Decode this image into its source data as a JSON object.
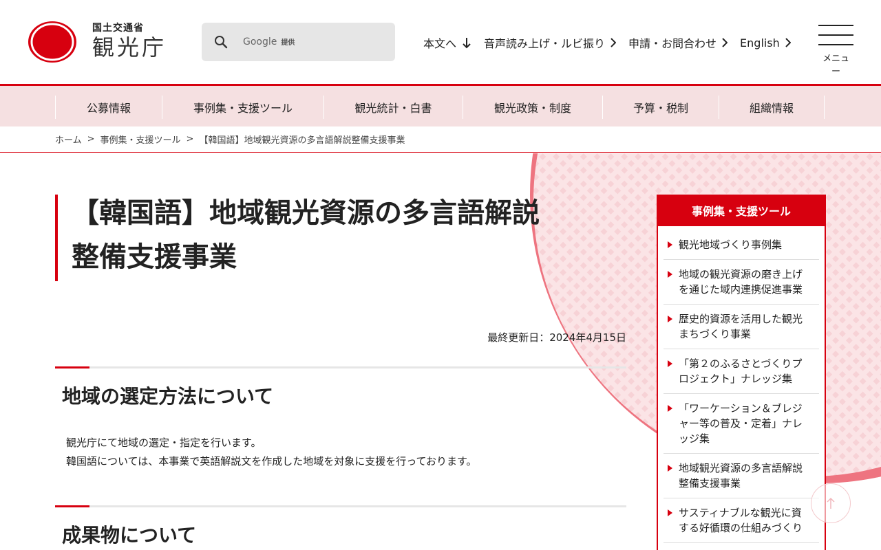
{
  "header": {
    "logo_sub": "国土交通省",
    "logo_main": "観光庁",
    "brand_color": "#d7000f",
    "search_provider": "Google",
    "search_suffix": "提供",
    "utility_links": [
      "本文へ",
      "音声読み上げ・ルビ振り",
      "申請・お問合わせ",
      "English"
    ],
    "menu_label": "メニュー"
  },
  "gnav": {
    "items": [
      "公募情報",
      "事例集・支援ツール",
      "観光統計・白書",
      "観光政策・制度",
      "予算・税制",
      "組織情報"
    ]
  },
  "breadcrumb": {
    "items": [
      "ホーム",
      "事例集・支援ツール",
      "【韓国語】地域観光資源の多言語解説整備支援事業"
    ],
    "separator": ">"
  },
  "main": {
    "title_line1": "【韓国語】地域観光資源の多言語解説",
    "title_line2": "整備支援事業",
    "updated": "最終更新日：2024年4月15日",
    "sections": [
      {
        "heading": "地域の選定方法について",
        "lines": [
          "観光庁にて地域の選定・指定を行います。",
          "韓国語については、本事業で英語解説文を作成した地域を対象に支援を行っております。"
        ]
      },
      {
        "heading": "成果物について",
        "lines": []
      }
    ]
  },
  "sidebar": {
    "heading": "事例集・支援ツール",
    "items": [
      [
        "観光地域づくり事例集"
      ],
      [
        "地域の観光資源の磨き上げ",
        "を通じた域内連携促進事業"
      ],
      [
        "歴史的資源を活用した観光",
        "まちづくり事業"
      ],
      [
        "「第２のふるさとづくりプ",
        "ロジェクト」ナレッジ集"
      ],
      [
        "「ワーケーション＆ブレジ",
        "ャー等の普及・定着」ナレ",
        "ッジ集"
      ],
      [
        "地域観光資源の多言語解説",
        "整備支援事業"
      ],
      [
        "サスティナブルな観光に資",
        "する好循環の仕組みづくり"
      ]
    ]
  },
  "pagetop_icon": "arrow-up-icon"
}
